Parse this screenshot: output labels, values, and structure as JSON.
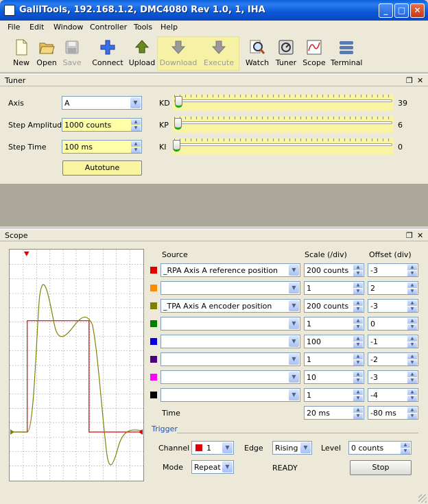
{
  "window": {
    "title": "GalilTools, 192.168.1.2, DMC4080 Rev 1.0, 1, IHA"
  },
  "menu": [
    "File",
    "Edit",
    "Window",
    "Controller",
    "Tools",
    "Help"
  ],
  "toolbar": [
    {
      "label": "New",
      "icon": "new-file-icon",
      "enabled": true
    },
    {
      "label": "Open",
      "icon": "open-folder-icon",
      "enabled": true
    },
    {
      "label": "Save",
      "icon": "save-disk-icon",
      "enabled": false
    },
    {
      "label": "Connect",
      "icon": "connect-cross-icon",
      "enabled": true
    },
    {
      "label": "Upload",
      "icon": "upload-arrow-icon",
      "enabled": true
    },
    {
      "label": "Download",
      "icon": "download-arrow-icon",
      "enabled": false
    },
    {
      "label": "Execute",
      "icon": "execute-arrow-icon",
      "enabled": false
    },
    {
      "label": "Watch",
      "icon": "watch-magnifier-icon",
      "enabled": true
    },
    {
      "label": "Tuner",
      "icon": "tuner-icon",
      "enabled": true
    },
    {
      "label": "Scope",
      "icon": "scope-icon",
      "enabled": true
    },
    {
      "label": "Terminal",
      "icon": "terminal-icon",
      "enabled": true
    }
  ],
  "tuner": {
    "title": "Tuner",
    "axis_label": "Axis",
    "axis_value": "A",
    "step_amplitude_label": "Step Amplitude",
    "step_amplitude_value": "1000 counts",
    "step_time_label": "Step Time",
    "step_time_value": "100 ms",
    "autotune_label": "Autotune",
    "sliders": [
      {
        "name": "KD",
        "value": "39"
      },
      {
        "name": "KP",
        "value": "6"
      },
      {
        "name": "KI",
        "value": "0"
      }
    ]
  },
  "scope": {
    "title": "Scope",
    "headers": {
      "source": "Source",
      "scale": "Scale (/div)",
      "offset": "Offset (div)"
    },
    "channels": [
      {
        "color": "#e00000",
        "source": "_RPA Axis A reference position",
        "scale": "200 counts",
        "offset": "-3"
      },
      {
        "color": "#ff8c00",
        "source": "",
        "scale": "1",
        "offset": "2"
      },
      {
        "color": "#808000",
        "source": "_TPA Axis A encoder position",
        "scale": "200 counts",
        "offset": "-3"
      },
      {
        "color": "#008000",
        "source": "",
        "scale": "1",
        "offset": "0"
      },
      {
        "color": "#0000e0",
        "source": "",
        "scale": "100",
        "offset": "-1"
      },
      {
        "color": "#4b0082",
        "source": "",
        "scale": "1",
        "offset": "-2"
      },
      {
        "color": "#ff00ff",
        "source": "",
        "scale": "10",
        "offset": "-3"
      },
      {
        "color": "#000000",
        "source": "",
        "scale": "1",
        "offset": "-4"
      }
    ],
    "time_label": "Time",
    "time_scale": "20 ms",
    "time_offset": "-80 ms",
    "trigger_label": "Trigger",
    "channel_label": "Channel",
    "channel_value": "1",
    "edge_label": "Edge",
    "edge_value": "Rising",
    "level_label": "Level",
    "level_value": "0 counts",
    "mode_label": "Mode",
    "mode_value": "Repeat",
    "status": "READY",
    "stop_label": "Stop"
  }
}
